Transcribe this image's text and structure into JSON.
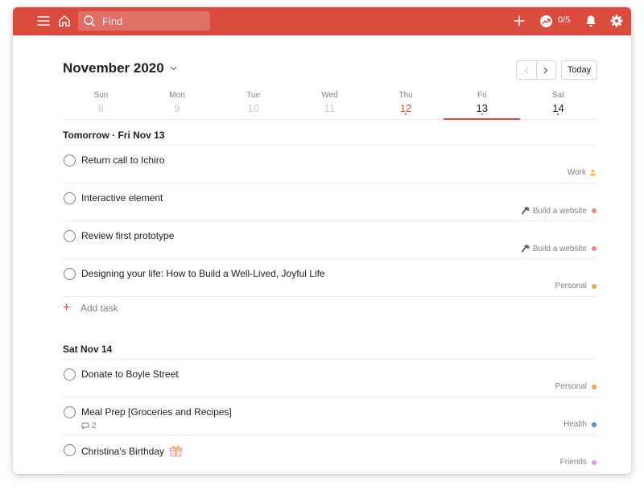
{
  "topbar": {
    "search_placeholder": "Find",
    "karma": "0/5",
    "icons": [
      "menu-icon",
      "home-icon",
      "search-icon",
      "plus-icon",
      "karma-icon",
      "bell-icon",
      "gear-icon"
    ],
    "color": "#db4c3f"
  },
  "header": {
    "month": "November 2020",
    "today_label": "Today"
  },
  "week": [
    {
      "name": "Sun",
      "num": "8",
      "state": "past"
    },
    {
      "name": "Mon",
      "num": "9",
      "state": "past"
    },
    {
      "name": "Tue",
      "num": "10",
      "state": "past"
    },
    {
      "name": "Wed",
      "num": "11",
      "state": "past"
    },
    {
      "name": "Thu",
      "num": "12",
      "state": "today"
    },
    {
      "name": "Fri",
      "num": "13",
      "state": "selected"
    },
    {
      "name": "Sat",
      "num": "14",
      "state": "future"
    }
  ],
  "sections": [
    {
      "title": "Tomorrow · Fri Nov 13",
      "tasks": [
        {
          "title": "Return call to Ichiro",
          "project": "Work",
          "project_color": "#f2c04d",
          "project_icon": "person-icon"
        },
        {
          "title": "Interactive element",
          "project": "Build a website",
          "project_color": "#eb8a7f",
          "project_icon": "hammer-icon"
        },
        {
          "title": "Review first prototype",
          "project": "Build a website",
          "project_color": "#eb8a7f",
          "project_icon": "hammer-icon"
        },
        {
          "title": "Designing your life: How to Build a Well-Lived, Joyful Life",
          "project": "Personal",
          "project_color": "#f2a444"
        }
      ],
      "add_task": "Add task"
    },
    {
      "title": "Sat Nov 14",
      "tasks": [
        {
          "title": "Donate to Boyle Street",
          "project": "Personal",
          "project_color": "#f2a444"
        },
        {
          "title": "Meal Prep [Groceries and Recipes]",
          "project": "Health",
          "project_color": "#4a90e2",
          "comments": "2"
        },
        {
          "title": "Christina's Birthday",
          "project": "Friends",
          "project_color": "#e59ae5",
          "emoji_icon": "gift-icon"
        }
      ]
    }
  ]
}
